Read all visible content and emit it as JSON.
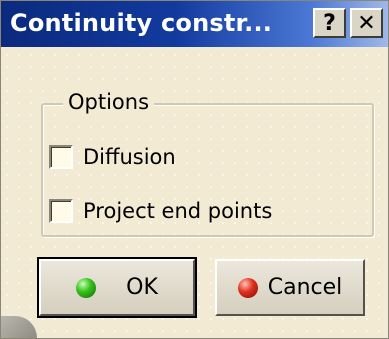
{
  "window": {
    "title": "Continuity constr...",
    "help_label": "?",
    "close_label": "✕"
  },
  "options": {
    "group_label": "Options",
    "checkboxes": [
      {
        "label": "Diffusion",
        "checked": false
      },
      {
        "label": "Project end points",
        "checked": false
      }
    ]
  },
  "buttons": {
    "ok_label": "OK",
    "cancel_label": "Cancel"
  },
  "icons": {
    "ok": "green-dot-icon",
    "cancel": "red-dot-icon"
  },
  "colors": {
    "titlebar": "#0b2a7e",
    "ok_dot": "#39c21d",
    "cancel_dot": "#e2301d"
  }
}
